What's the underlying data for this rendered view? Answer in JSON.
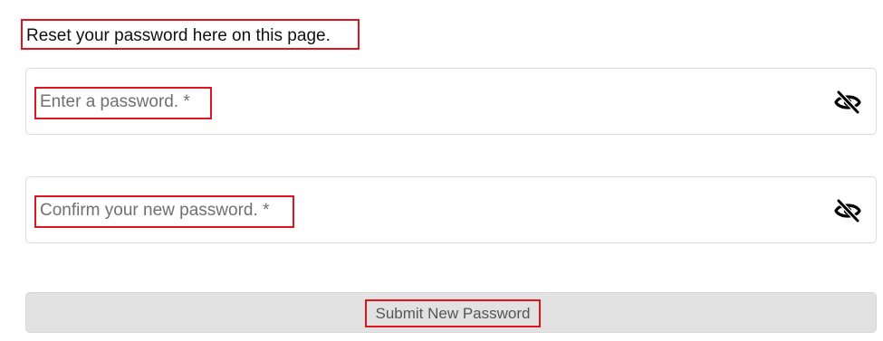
{
  "heading": "Reset your password here on this page.",
  "fields": [
    {
      "placeholder": "Enter a password. *",
      "toggle_icon": "eye-slash-icon"
    },
    {
      "placeholder": "Confirm your new password. *",
      "toggle_icon": "eye-slash-icon"
    }
  ],
  "submit": {
    "label": "Submit New Password"
  },
  "colors": {
    "highlight_border": "#e0141e",
    "button_bg": "#e2e2e2",
    "placeholder": "#707070"
  }
}
